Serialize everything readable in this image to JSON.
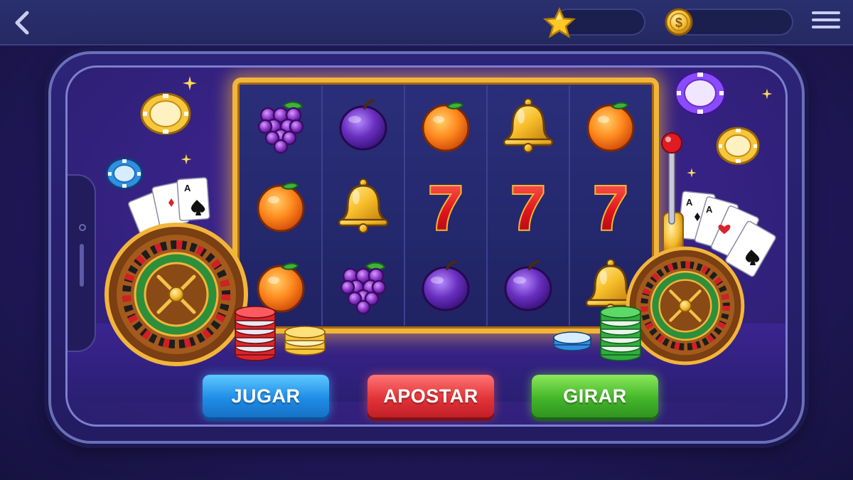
{
  "topbar": {
    "back_icon": "chevron-left-icon",
    "star_icon": "star-icon",
    "coin_icon": "dollar-coin-icon",
    "menu_icon": "hamburger-menu-icon"
  },
  "reels": [
    [
      "grapes",
      "orange",
      "orange"
    ],
    [
      "plum",
      "bell",
      "grapes"
    ],
    [
      "orange",
      "seven",
      "plum"
    ],
    [
      "bell",
      "seven",
      "plum"
    ],
    [
      "orange",
      "seven",
      "bell"
    ]
  ],
  "symbol_text": {
    "seven": "7"
  },
  "decorations": [
    "roulette-wheel-left",
    "roulette-wheel-right",
    "playing-cards-left",
    "playing-cards-right",
    "poker-chip-gold",
    "poker-chip-blue",
    "poker-chip-purple",
    "chip-stacks",
    "slot-lever",
    "sparkles"
  ],
  "buttons": {
    "play_label": "JUGAR",
    "bet_label": "APOSTAR",
    "spin_label": "GIRAR"
  },
  "colors": {
    "reel_frame": "#f2b53a",
    "play": "#1f8de6",
    "bet": "#e23438",
    "spin": "#44b62a"
  }
}
